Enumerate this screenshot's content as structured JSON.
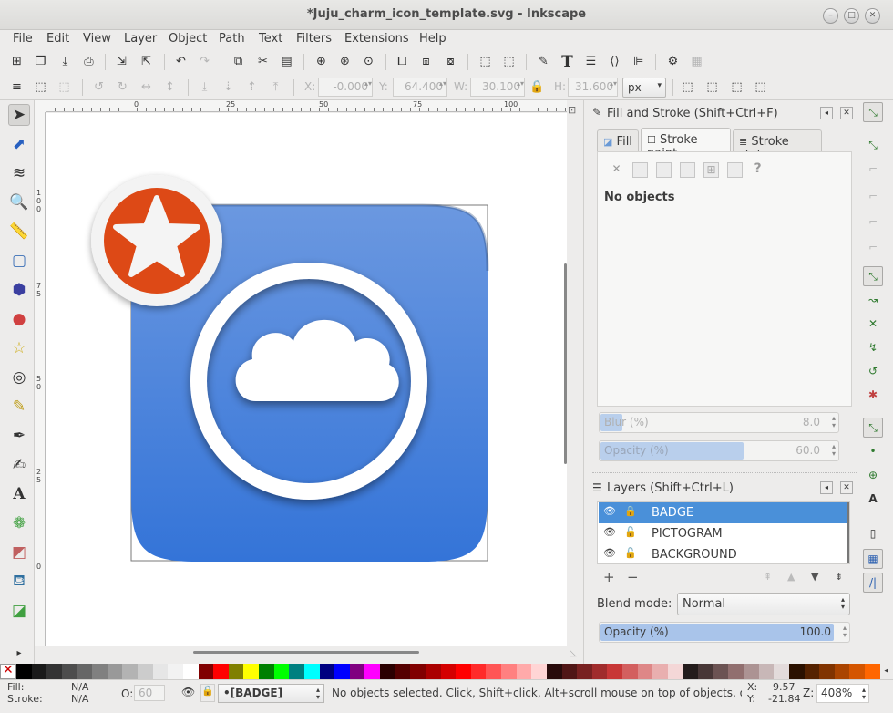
{
  "window": {
    "title": "*Juju_charm_icon_template.svg - Inkscape"
  },
  "menu": [
    "File",
    "Edit",
    "View",
    "Layer",
    "Object",
    "Path",
    "Text",
    "Filters",
    "Extensions",
    "Help"
  ],
  "controls": {
    "x_label": "X:",
    "x_value": "-0.000",
    "y_label": "Y:",
    "y_value": "64.400",
    "w_label": "W:",
    "w_value": "30.100",
    "h_label": "H:",
    "h_value": "31.600",
    "units": "px"
  },
  "ruler": {
    "h_ticks": [
      "0",
      "25",
      "50",
      "75",
      "100"
    ],
    "v_ticks": [
      "1",
      "0",
      "0",
      "7",
      "5",
      "5",
      "0",
      "2",
      "5",
      "0"
    ]
  },
  "fill_stroke": {
    "title": "Fill and Stroke (Shift+Ctrl+F)",
    "tabs": [
      "Fill",
      "Stroke paint",
      "Stroke style"
    ],
    "unset_icon": "✕",
    "unknown_icon": "?",
    "empty_text": "No objects",
    "blur": {
      "label": "Blur (%)",
      "value": "8.0",
      "fraction": 0.09
    },
    "opacity": {
      "label": "Opacity (%)",
      "value": "60.0",
      "fraction": 0.6
    }
  },
  "layers": {
    "title": "Layers (Shift+Ctrl+L)",
    "items": [
      {
        "name": "BADGE",
        "selected": true
      },
      {
        "name": "PICTOGRAM",
        "selected": false
      },
      {
        "name": "BACKGROUND",
        "selected": false
      }
    ],
    "blend_label": "Blend mode:",
    "blend_value": "Normal",
    "opacity_label": "Opacity (%)",
    "opacity_value": "100.0",
    "opacity_fraction": 1.0
  },
  "palette": [
    "#000000",
    "#1a1a1a",
    "#333333",
    "#4d4d4d",
    "#666666",
    "#808080",
    "#999999",
    "#b3b3b3",
    "#cccccc",
    "#e6e6e6",
    "#f2f2f2",
    "#ffffff",
    "#800000",
    "#ff0000",
    "#808000",
    "#ffff00",
    "#008000",
    "#00ff00",
    "#008080",
    "#00ffff",
    "#000080",
    "#0000ff",
    "#800080",
    "#ff00ff",
    "#2b0000",
    "#550000",
    "#800000",
    "#aa0000",
    "#d40000",
    "#ff0000",
    "#ff2a2a",
    "#ff5555",
    "#ff8080",
    "#ffaaaa",
    "#ffd5d5",
    "#280b0b",
    "#501616",
    "#782121",
    "#a02c2c",
    "#c83737",
    "#d35f5f",
    "#de8787",
    "#e9afaf",
    "#f4d7d7",
    "#241c1c",
    "#483737",
    "#6c5353",
    "#916f6f",
    "#ac9393",
    "#c8b7b7",
    "#e3dbdb",
    "#2b1100",
    "#552200",
    "#803300",
    "#aa4400",
    "#d45500",
    "#ff6600"
  ],
  "status": {
    "fill_label": "Fill:",
    "fill_value": "N/A",
    "stroke_label": "Stroke:",
    "stroke_value": "N/A",
    "o_label": "O:",
    "o_value": "60",
    "layer": "•[BADGE]",
    "message": "No objects selected. Click, Shift+click, Alt+scroll mouse on top of objects, or...",
    "x_label": "X:",
    "x_value": "9.57",
    "y_label": "Y:",
    "y_value": "-21.84",
    "z_label": "Z:",
    "zoom": "408%"
  }
}
